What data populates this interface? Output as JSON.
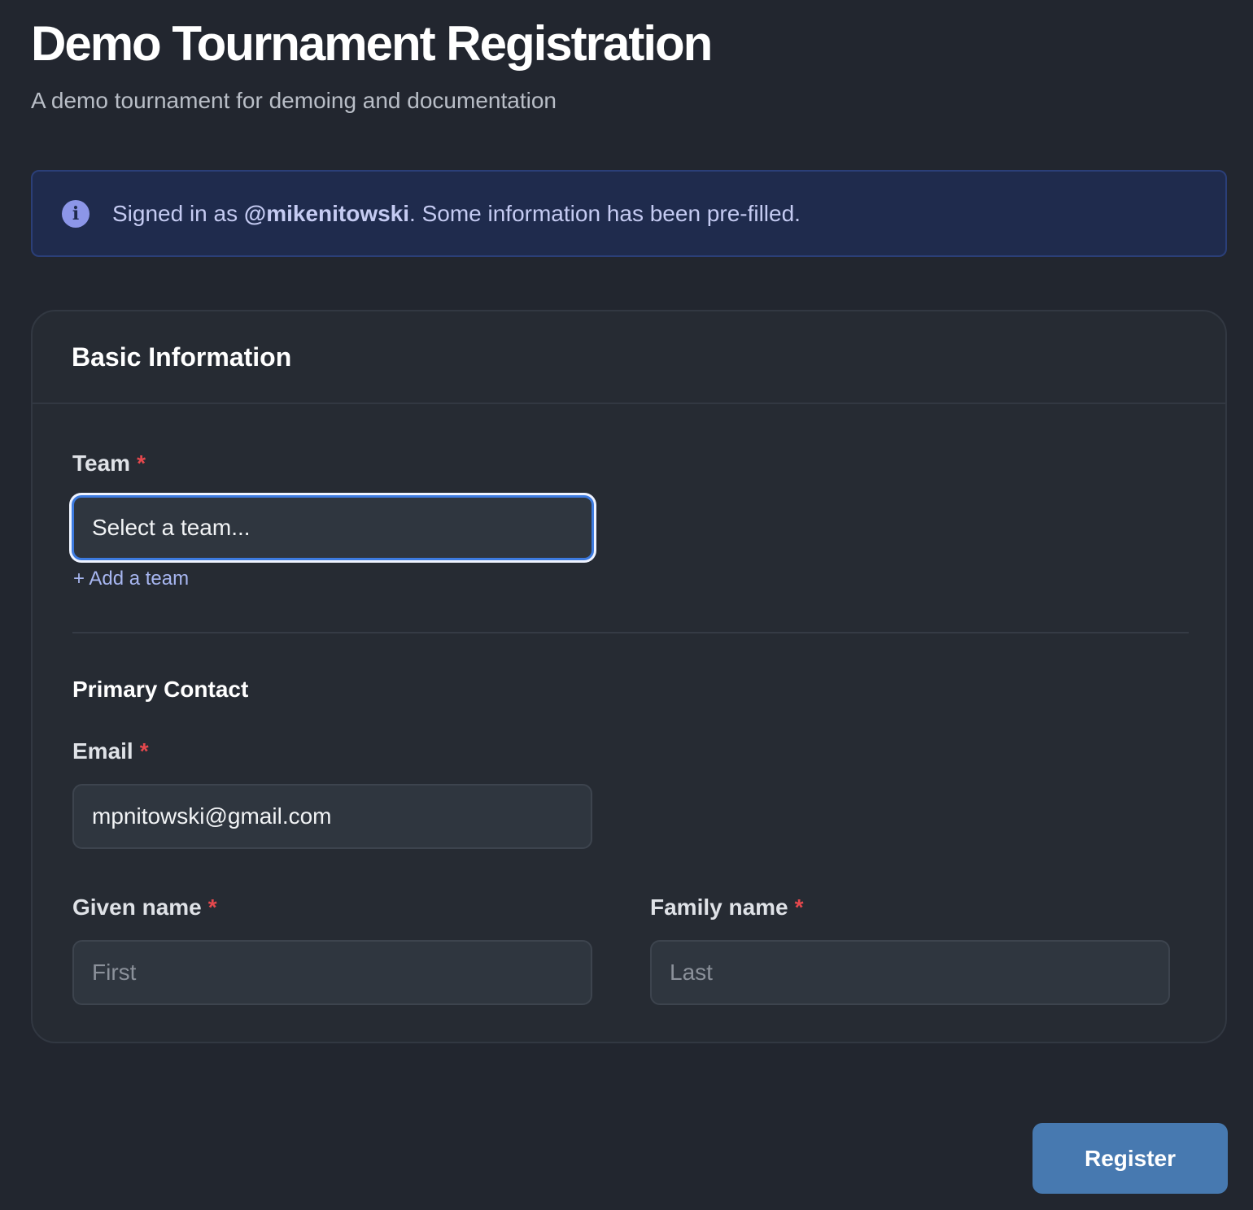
{
  "header": {
    "title": "Demo Tournament Registration",
    "subtitle": "A demo tournament for demoing and documentation"
  },
  "alert": {
    "icon": "info-icon",
    "prefix": "Signed in as ",
    "username": "@mikenitowski",
    "suffix": ". Some information has been pre-filled.",
    "bg_color": "#1f2b4d",
    "text_color": "#c5cbf2"
  },
  "basic_info": {
    "title": "Basic Information",
    "team": {
      "label": "Team",
      "required_mark": "*",
      "value": "Select a team...",
      "add_link": "+ Add a team"
    },
    "primary_contact": {
      "title": "Primary Contact",
      "email": {
        "label": "Email",
        "required_mark": "*",
        "value": "mpnitowski@gmail.com"
      },
      "given_name": {
        "label": "Given name",
        "required_mark": "*",
        "placeholder": "First"
      },
      "family_name": {
        "label": "Family name",
        "required_mark": "*",
        "placeholder": "Last"
      }
    }
  },
  "actions": {
    "register_label": "Register",
    "accent_color": "#4779b0"
  }
}
